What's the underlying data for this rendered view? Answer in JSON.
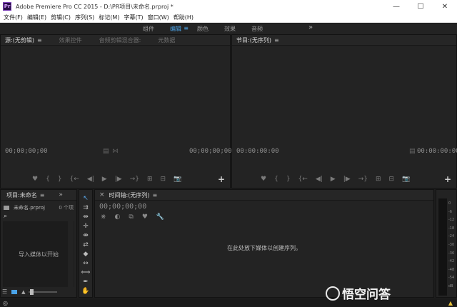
{
  "window": {
    "app_logo": "Pr",
    "title": "Adobe Premiere Pro CC 2015 - D:\\PR项目\\未命名.prproj *",
    "minimize": "—",
    "maximize": "☐",
    "close": "✕"
  },
  "menu": [
    "文件(F)",
    "编辑(E)",
    "剪辑(C)",
    "序列(S)",
    "标记(M)",
    "字幕(T)",
    "窗口(W)",
    "帮助(H)"
  ],
  "workspaces": {
    "tabs": [
      "组件",
      "编辑",
      "颜色",
      "效果",
      "音频"
    ],
    "active_index": 1,
    "menu_glyph": "≡",
    "more": "»"
  },
  "source_panel": {
    "tabs": [
      "源:(无剪辑)",
      "效果控件",
      "音频剪辑混合器:",
      "元数据"
    ],
    "tab_menu": "≡",
    "timecode_left": "00;00;00;00",
    "timecode_right": "00;00;00;00"
  },
  "program_panel": {
    "tab": "节目:(无序列)",
    "tab_menu": "≡",
    "timecode_left": "00:00:00:00",
    "timecode_right": "00:00:00:00"
  },
  "transport_glyphs": [
    "♥",
    "{",
    "}",
    "{←",
    "◀|",
    "▶",
    "|▶",
    "→}",
    "⊞",
    "⊟",
    "📷"
  ],
  "add_glyph": "+",
  "project_panel": {
    "tab": "项目:未命名",
    "tab_menu": "≡",
    "more": "»",
    "filename": "未命名.prproj",
    "item_count": "0 个项",
    "search_glyph": "⌕",
    "empty_text": "导入媒体以开始"
  },
  "timeline_panel": {
    "close_glyph": "×",
    "tab": "时间轴:(无序列)",
    "tab_menu": "≡",
    "timecode": "00;00;00;00",
    "empty_text": "在此处放下媒体以创建序列。"
  },
  "tools": [
    "↖",
    "⇉",
    "⇹",
    "✛",
    "⇼",
    "⇄",
    "◆",
    "↔",
    "⟺",
    "✒",
    "✋"
  ],
  "meter_labels": [
    "0",
    "-6",
    "-12",
    "-18",
    "-24",
    "-30",
    "-36",
    "-42",
    "-48",
    "-54",
    "dB"
  ],
  "watermark": {
    "glyph": "悟",
    "text": "悟空问答"
  }
}
